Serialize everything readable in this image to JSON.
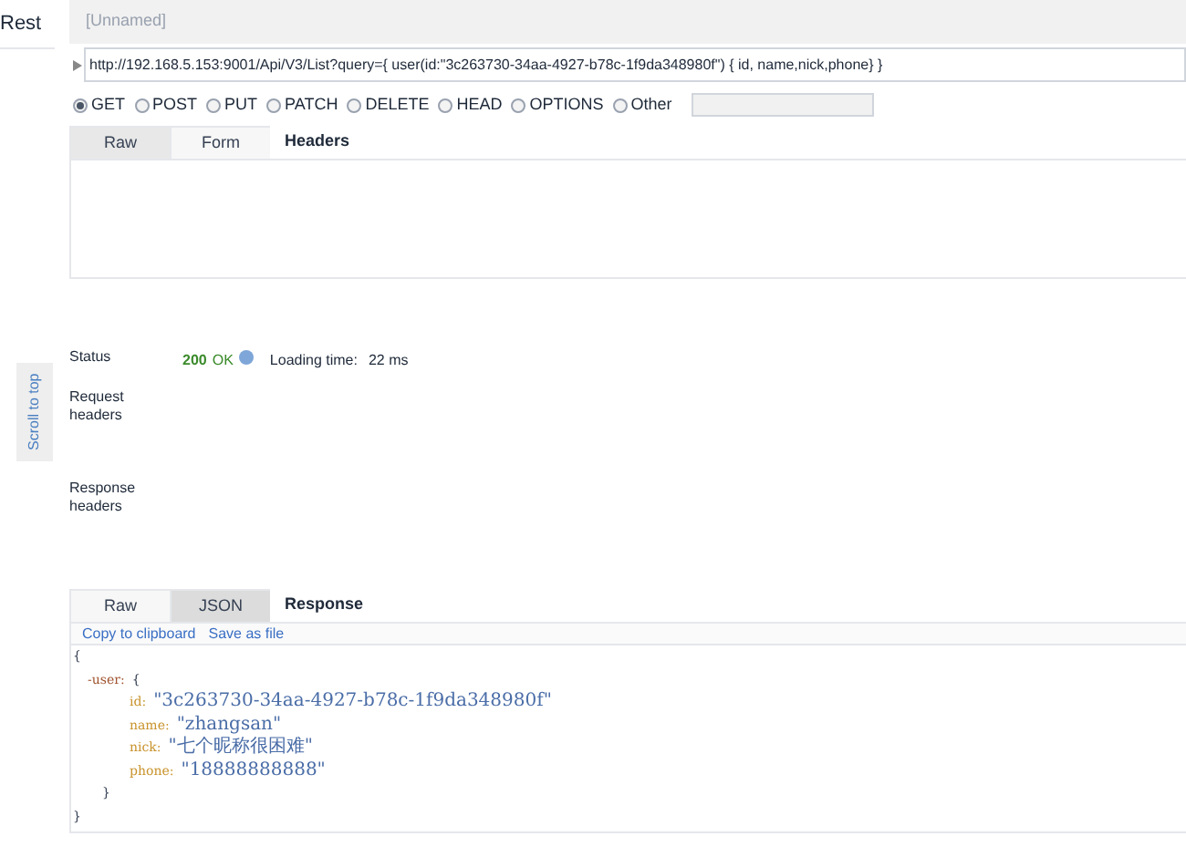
{
  "sidebar": {
    "title": "Rest",
    "scroll_button": "Scroll to top"
  },
  "request": {
    "name": "[Unnamed]",
    "url": "http://192.168.5.153:9001/Api/V3/List?query={ user(id:\"3c263730-34aa-4927-b78c-1f9da348980f\") { id, name,nick,phone} }",
    "methods": [
      {
        "label": "GET",
        "selected": true
      },
      {
        "label": "POST",
        "selected": false
      },
      {
        "label": "PUT",
        "selected": false
      },
      {
        "label": "PATCH",
        "selected": false
      },
      {
        "label": "DELETE",
        "selected": false
      },
      {
        "label": "HEAD",
        "selected": false
      },
      {
        "label": "OPTIONS",
        "selected": false
      },
      {
        "label": "Other",
        "selected": false
      }
    ],
    "tabs": [
      {
        "label": "Raw",
        "selected": true
      },
      {
        "label": "Form",
        "selected": false
      }
    ],
    "tabs_title": "Headers"
  },
  "result": {
    "status_label": "Status",
    "status_code": "200",
    "status_text": "OK",
    "loading_label": "Loading time:",
    "loading_value": "22 ms",
    "request_headers_label": "Request headers",
    "response_headers_label": "Response headers"
  },
  "response": {
    "tabs": [
      {
        "label": "Raw",
        "selected": false
      },
      {
        "label": "JSON",
        "selected": true
      }
    ],
    "tabs_title": "Response",
    "actions": [
      "Copy to clipboard",
      "Save as file"
    ],
    "open_brace": "{",
    "object_key": "-user:",
    "object_open": "{",
    "fields": [
      {
        "key": "id:",
        "value": "\"3c263730-34aa-4927-b78c-1f9da348980f\""
      },
      {
        "key": "name:",
        "value": "\"zhangsan\""
      },
      {
        "key": "nick:",
        "value": "\"七个昵称很困难\""
      },
      {
        "key": "phone:",
        "value": "\"18888888888\""
      }
    ],
    "object_close": "}",
    "close_brace": "}"
  }
}
